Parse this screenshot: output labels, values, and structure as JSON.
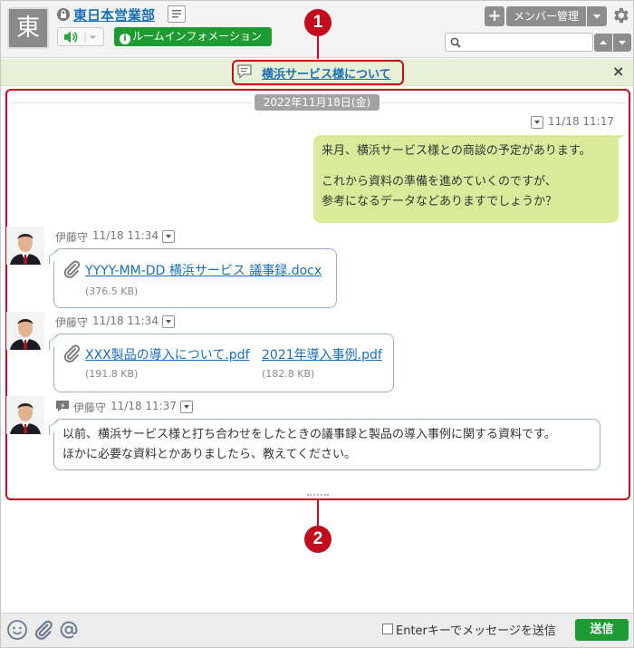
{
  "room": {
    "avatar_char": "東",
    "title": "東日本営業部",
    "info_button": "ルームインフォメーション"
  },
  "header": {
    "member_button": "メンバー管理",
    "search_placeholder": ""
  },
  "topic": {
    "link": "横浜サービス様について"
  },
  "timeline": {
    "date_separator": "2022年11月18日(金)",
    "messages": [
      {
        "time": "11/18 11:17",
        "lines": [
          "来月、横浜サービス様との商談の予定があります。",
          "",
          "これから資料の準備を進めていくのですが、",
          "参考になるデータなどありますでしょうか？"
        ]
      },
      {
        "author": "伊藤守",
        "time": "11/18 11:34",
        "files": [
          {
            "name": "YYYY-MM-DD 横浜サービス 議事録.docx",
            "size": "(376.5 KB)"
          }
        ]
      },
      {
        "author": "伊藤守",
        "time": "11/18 11:34",
        "files": [
          {
            "name": "XXX製品の導入について.pdf",
            "size": "(191.8 KB)"
          },
          {
            "name": "2021年導入事例.pdf",
            "size": "(182.8 KB)"
          }
        ]
      },
      {
        "author": "伊藤守",
        "time": "11/18 11:37",
        "lines": [
          "以前、横浜サービス様と打ち合わせをしたときの議事録と製品の導入事例に関する資料です。",
          "ほかに必要な資料とかありましたら、教えてください。"
        ]
      }
    ]
  },
  "annotations": {
    "badge1": "1",
    "badge2": "2"
  },
  "footer": {
    "enter_label": "Enterキーでメッセージを送信",
    "send_button": "送信"
  },
  "colors": {
    "accent_green": "#1e9b32",
    "link_blue": "#1b6fb8",
    "annotation_red": "#c00c1c",
    "my_bubble": "#d9eb9a"
  }
}
